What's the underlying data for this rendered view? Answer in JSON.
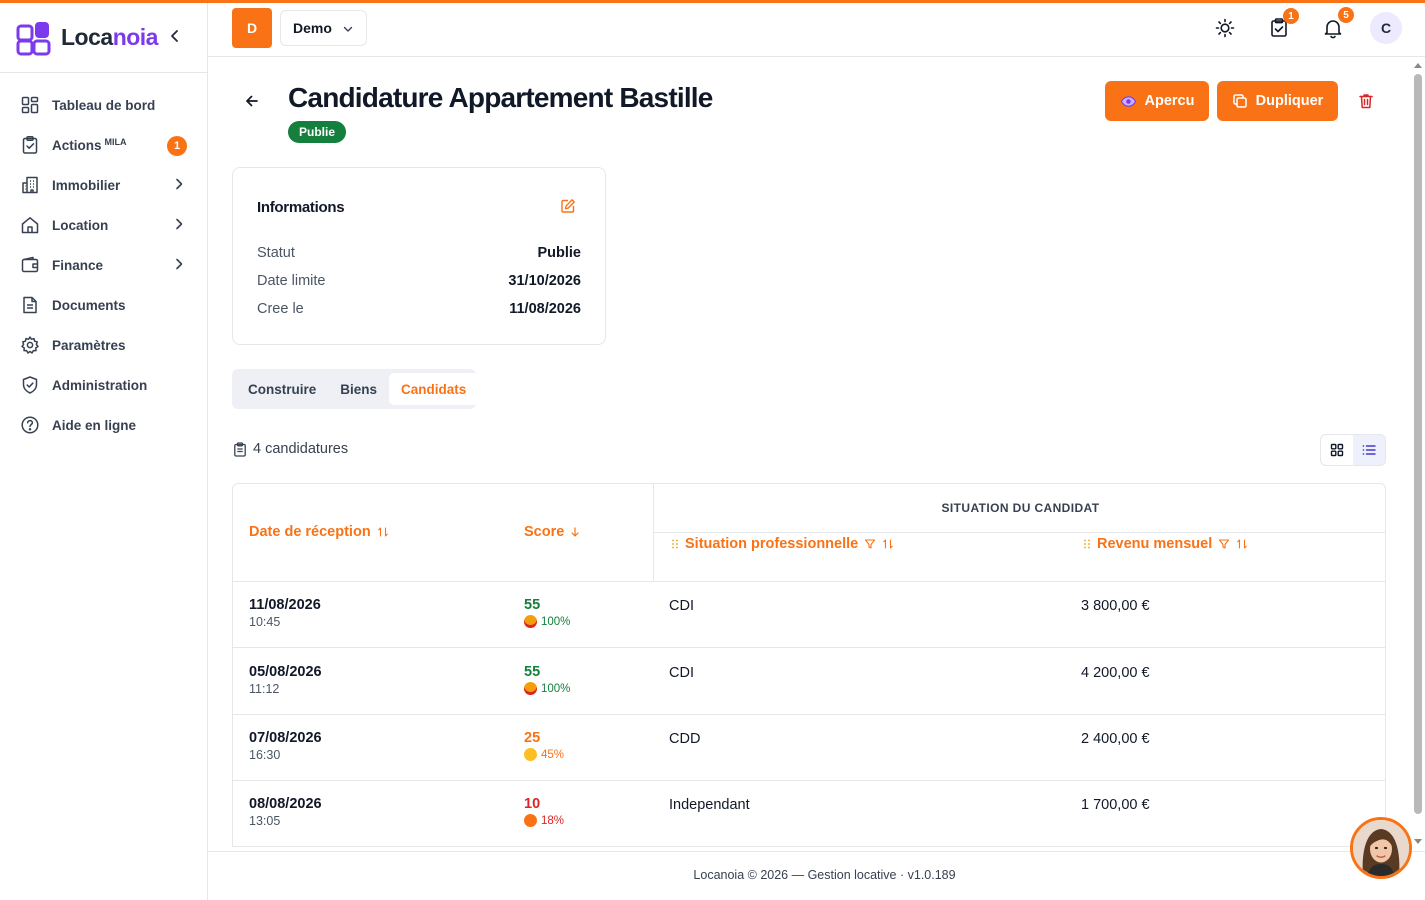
{
  "app": {
    "brand_part1": "Loca",
    "brand_part2": "noia",
    "accent": "#f97316",
    "brand_color": "#7c3aed"
  },
  "sidebar": {
    "items": [
      {
        "label": "Tableau de bord",
        "icon": "dashboard-icon"
      },
      {
        "label": "Actions",
        "sup": "MILA",
        "badge": "1",
        "icon": "clipboard-check-icon"
      },
      {
        "label": "Immobilier",
        "icon": "building-icon",
        "chevron": true
      },
      {
        "label": "Location",
        "icon": "home-icon",
        "chevron": true
      },
      {
        "label": "Finance",
        "icon": "wallet-icon",
        "chevron": true
      },
      {
        "label": "Documents",
        "icon": "document-icon"
      },
      {
        "label": "Paramètres",
        "icon": "gear-icon"
      },
      {
        "label": "Administration",
        "icon": "shield-icon"
      },
      {
        "label": "Aide en ligne",
        "icon": "help-circle-icon"
      }
    ]
  },
  "header": {
    "workspace_initial": "D",
    "workspace_name": "Demo",
    "tasks_badge": "1",
    "notifications_badge": "5",
    "user_initial": "C"
  },
  "page": {
    "title": "Candidature Appartement Bastille",
    "status": "Publie",
    "status_color": "#15803d",
    "preview_label": "Apercu",
    "duplicate_label": "Dupliquer"
  },
  "info": {
    "title": "Informations",
    "rows": [
      {
        "label": "Statut",
        "value": "Publie"
      },
      {
        "label": "Date limite",
        "value": "31/10/2026"
      },
      {
        "label": "Cree le",
        "value": "11/08/2026"
      }
    ]
  },
  "tabs": [
    {
      "label": "Construire",
      "active": false
    },
    {
      "label": "Biens",
      "active": false
    },
    {
      "label": "Candidats",
      "active": true
    }
  ],
  "candidates": {
    "count_label": "4 candidatures",
    "group_header": "SITUATION DU CANDIDAT",
    "columns": {
      "date": "Date de réception",
      "score": "Score",
      "situation": "Situation professionnelle",
      "revenue": "Revenu mensuel"
    },
    "rows": [
      {
        "date": "11/08/2026",
        "time": "10:45",
        "score": "55",
        "percent": "100%",
        "level": "green",
        "situation": "CDI",
        "revenue": "3 800,00 €"
      },
      {
        "date": "05/08/2026",
        "time": "11:12",
        "score": "55",
        "percent": "100%",
        "level": "green",
        "situation": "CDI",
        "revenue": "4 200,00 €"
      },
      {
        "date": "07/08/2026",
        "time": "16:30",
        "score": "25",
        "percent": "45%",
        "level": "orange",
        "situation": "CDD",
        "revenue": "2 400,00 €"
      },
      {
        "date": "08/08/2026",
        "time": "13:05",
        "score": "10",
        "percent": "18%",
        "level": "red",
        "situation": "Independant",
        "revenue": "1 700,00 €"
      }
    ]
  },
  "footer": {
    "text": "Locanoia © 2026 — Gestion locative · v1.0.189"
  }
}
